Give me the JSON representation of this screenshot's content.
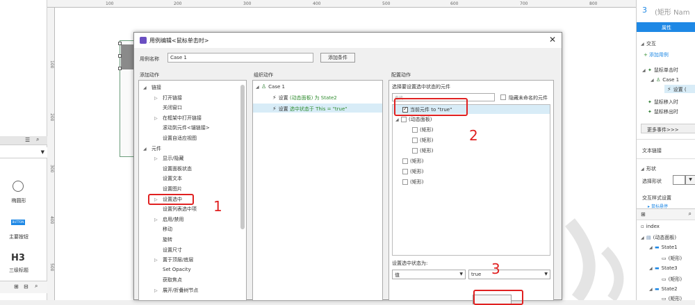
{
  "left_panel": {
    "library_items": [
      {
        "label": "椭圆形"
      },
      {
        "label": "主要按钮",
        "button_text": "BUTTON"
      },
      {
        "label": "三级标题",
        "glyph": "H3"
      }
    ]
  },
  "rulers": {
    "top": [
      "100",
      "200",
      "300",
      "400",
      "500",
      "600",
      "700",
      "800"
    ],
    "left": [
      "100",
      "200",
      "300",
      "400",
      "500"
    ]
  },
  "dialog": {
    "title": "用例编辑<鼠标单击时>",
    "case_name_label": "用例名称",
    "case_name_value": "Case 1",
    "add_condition_button": "添加条件",
    "sections": {
      "add_action": "添加动作",
      "organize_action": "组织动作",
      "config_action": "配置动作"
    },
    "actions_tree": [
      {
        "label": "链接",
        "level": 0,
        "arrow": "◢"
      },
      {
        "label": "打开链接",
        "level": 1,
        "arrow": "▷"
      },
      {
        "label": "关闭窗口",
        "level": 1,
        "arrow": ""
      },
      {
        "label": "在框架中打开链接",
        "level": 1,
        "arrow": "▷"
      },
      {
        "label": "滚动到元件<锚链接>",
        "level": 1,
        "arrow": ""
      },
      {
        "label": "设置自适应视图",
        "level": 1,
        "arrow": ""
      },
      {
        "label": "元件",
        "level": 0,
        "arrow": "◢"
      },
      {
        "label": "显示/隐藏",
        "level": 1,
        "arrow": "▷"
      },
      {
        "label": "设置面板状态",
        "level": 1,
        "arrow": ""
      },
      {
        "label": "设置文本",
        "level": 1,
        "arrow": ""
      },
      {
        "label": "设置图片",
        "level": 1,
        "arrow": ""
      },
      {
        "label": "设置选中",
        "level": 1,
        "arrow": "▷"
      },
      {
        "label": "设置列表选中项",
        "level": 1,
        "arrow": ""
      },
      {
        "label": "启用/禁用",
        "level": 1,
        "arrow": "▷"
      },
      {
        "label": "移动",
        "level": 1,
        "arrow": ""
      },
      {
        "label": "旋转",
        "level": 1,
        "arrow": ""
      },
      {
        "label": "设置尺寸",
        "level": 1,
        "arrow": ""
      },
      {
        "label": "置于顶层/底层",
        "level": 1,
        "arrow": "▷"
      },
      {
        "label": "Set Opacity",
        "level": 1,
        "arrow": ""
      },
      {
        "label": "获取焦点",
        "level": 1,
        "arrow": ""
      },
      {
        "label": "展开/折叠树节点",
        "level": 1,
        "arrow": "▷"
      }
    ],
    "organize": {
      "case_label": "Case 1",
      "action1_prefix": "设置 ",
      "action1_green": "(动态面板) 为 State2",
      "action2_prefix": "设置 ",
      "action2_green": "选中状态于 This = \"true\""
    },
    "config": {
      "select_label": "选择要设置选中状态的元件",
      "search_placeholder": "查找",
      "hide_unnamed_label": "隐藏未命名的元件",
      "current_element_label": "当前元件 to \"true\"",
      "dynamic_panel_label": "(动态面板)",
      "rect_label": "(矩形)",
      "set_selected_label": "设置选中状态为:",
      "value_select": "值",
      "value_input": "true"
    },
    "annotations": [
      "1",
      "2",
      "3"
    ]
  },
  "right_panel": {
    "title_number": "3",
    "title_text": "(矩形 Nam",
    "tab_label": "属性",
    "interaction_label": "交互",
    "add_case_link": "添加用例",
    "events": [
      {
        "label": "鼠标单击时",
        "level": 0
      },
      {
        "label": "Case 1",
        "level": 1
      },
      {
        "label": "设置 (",
        "level": 2
      },
      {
        "label": "鼠标移入时",
        "level": 0
      },
      {
        "label": "鼠标移出时",
        "level": 0
      }
    ],
    "more_events": "更多事件>>>",
    "text_link": "文本链接",
    "shape_label": "形状",
    "select_shape": "选择形状",
    "style_settings": "交互样式设置",
    "mouse_hover": "鼠标悬停",
    "outline": [
      {
        "label": "index",
        "level": 0
      },
      {
        "label": "(动态面板)",
        "level": 0
      },
      {
        "label": "State1",
        "level": 1
      },
      {
        "label": "(矩形)",
        "level": 2
      },
      {
        "label": "State3",
        "level": 1
      },
      {
        "label": "(矩形)",
        "level": 2
      },
      {
        "label": "State2",
        "level": 1
      },
      {
        "label": "(矩形)",
        "level": 2
      }
    ]
  }
}
